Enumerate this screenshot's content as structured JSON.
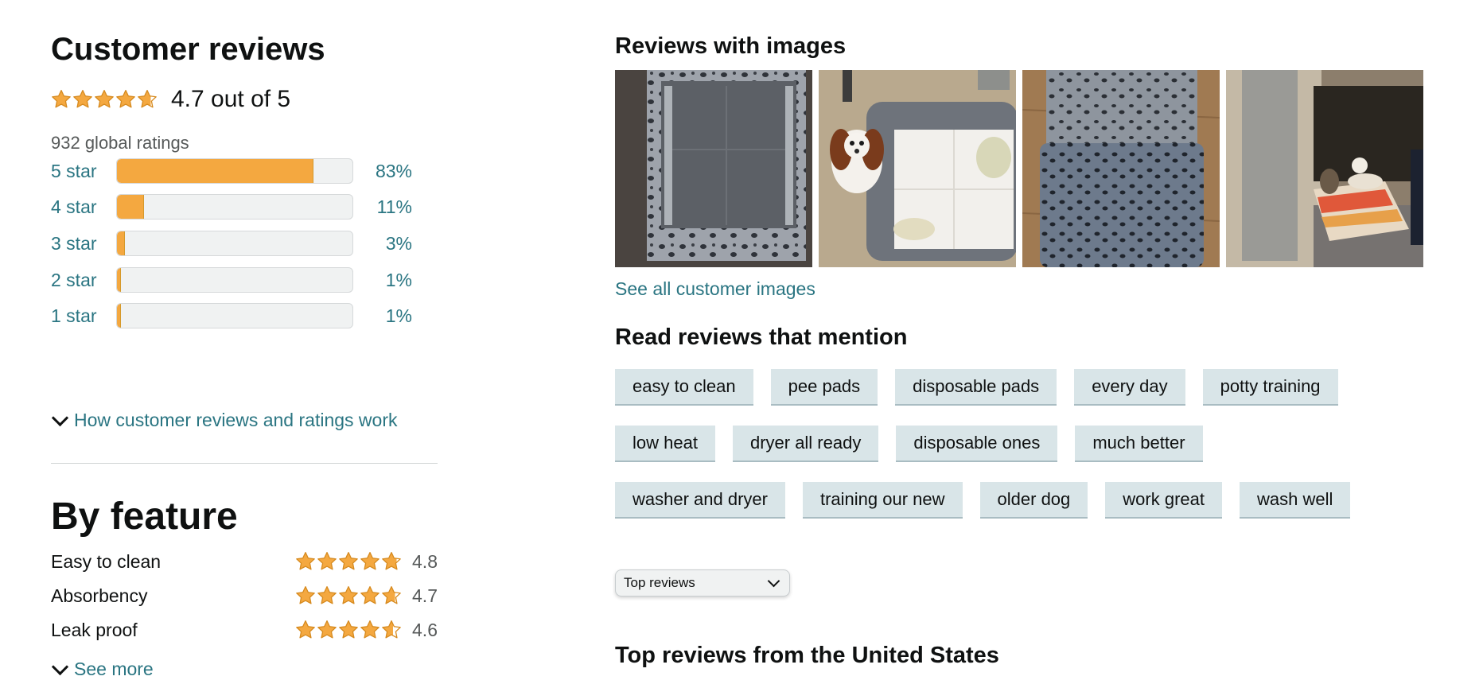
{
  "customer_reviews": {
    "title": "Customer reviews",
    "rating": 4.7,
    "rating_text": "4.7 out of 5",
    "global_ratings": "932 global ratings",
    "star_icon": "star-icon",
    "histogram": [
      {
        "label": "5 star",
        "percent_text": "83%",
        "fraction": 0.83
      },
      {
        "label": "4 star",
        "percent_text": "11%",
        "fraction": 0.11
      },
      {
        "label": "3 star",
        "percent_text": "3%",
        "fraction": 0.03
      },
      {
        "label": "2 star",
        "percent_text": "1%",
        "fraction": 0.01
      },
      {
        "label": "1 star",
        "percent_text": "1%",
        "fraction": 0.01
      }
    ],
    "how_link": "How customer reviews and ratings work"
  },
  "by_feature": {
    "title": "By feature",
    "features": [
      {
        "name": "Easy to clean",
        "score": "4.8",
        "rating": 4.8
      },
      {
        "name": "Absorbency",
        "score": "4.7",
        "rating": 4.7
      },
      {
        "name": "Leak proof",
        "score": "4.6",
        "rating": 4.6
      }
    ],
    "see_more": "See more"
  },
  "reviews_with_images": {
    "title": "Reviews with images",
    "see_all": "See all customer images"
  },
  "mentions": {
    "title": "Read reviews that mention",
    "rows": [
      [
        "easy to clean",
        "pee pads",
        "disposable pads",
        "every day",
        "potty training"
      ],
      [
        "low heat",
        "dryer all ready",
        "disposable ones",
        "much better"
      ],
      [
        "washer and dryer",
        "training our new",
        "older dog",
        "work great",
        "wash well"
      ]
    ]
  },
  "sort": {
    "selected": "Top reviews"
  },
  "top_reviews_heading": "Top reviews from the United States",
  "colors": {
    "star": "#f4a840",
    "link": "#2a7582",
    "chip": "#d9e5e8"
  }
}
